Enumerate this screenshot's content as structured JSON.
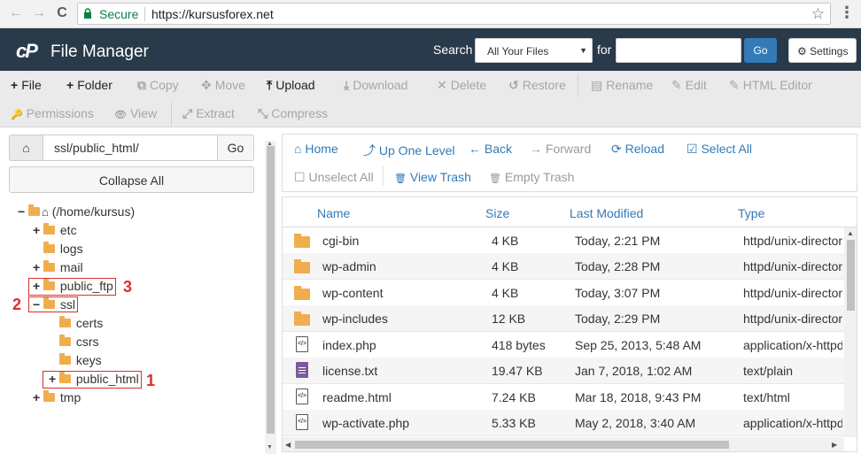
{
  "browser": {
    "back_glyph": "←",
    "forward_glyph": "→",
    "reload_glyph": "C",
    "secure_label": "Secure",
    "url": "https://kursusforex.net",
    "star_glyph": "☆",
    "menu_glyph": "⋮"
  },
  "header": {
    "logo_text": "cP",
    "title": "File Manager",
    "search_label": "Search",
    "search_scope": "All Your Files",
    "for_label": "for",
    "search_value": "",
    "go_label": "Go",
    "settings_label": "Settings"
  },
  "toolbar": {
    "row1": [
      {
        "icon": "+",
        "label": "File",
        "enabled": true
      },
      {
        "icon": "+",
        "label": "Folder",
        "enabled": true
      },
      {
        "icon": "⧉",
        "label": "Copy",
        "enabled": false
      },
      {
        "icon": "✥",
        "label": "Move",
        "enabled": false
      },
      {
        "icon": "⤒",
        "label": "Upload",
        "enabled": true
      },
      {
        "icon": "⤓",
        "label": "Download",
        "enabled": false
      },
      {
        "icon": "✕",
        "label": "Delete",
        "enabled": false
      },
      {
        "icon": "↺",
        "label": "Restore",
        "enabled": false
      },
      {
        "icon": "▤",
        "label": "Rename",
        "enabled": false
      },
      {
        "icon": "✎",
        "label": "Edit",
        "enabled": false
      },
      {
        "icon": "✎",
        "label": "HTML Editor",
        "enabled": false
      }
    ],
    "row2": [
      {
        "icon": "🔑",
        "label": "Permissions",
        "enabled": false
      },
      {
        "icon": "👁",
        "label": "View",
        "enabled": false
      },
      {
        "icon": "⤢",
        "label": "Extract",
        "enabled": false
      },
      {
        "icon": "⤡",
        "label": "Compress",
        "enabled": false
      }
    ]
  },
  "left_panel": {
    "path_value": "ssl/public_html/",
    "go_label": "Go",
    "collapse_label": "Collapse All",
    "tree": [
      {
        "toggle": "−",
        "label": "(/home/kursus)",
        "level": 0,
        "home": true
      },
      {
        "toggle": "+",
        "label": "etc",
        "level": 1
      },
      {
        "toggle": "",
        "label": "logs",
        "level": 1
      },
      {
        "toggle": "+",
        "label": "mail",
        "level": 1
      },
      {
        "toggle": "+",
        "label": "public_ftp",
        "level": 1
      },
      {
        "toggle": "−",
        "label": "ssl",
        "level": 1
      },
      {
        "toggle": "",
        "label": "certs",
        "level": 2
      },
      {
        "toggle": "",
        "label": "csrs",
        "level": 2
      },
      {
        "toggle": "",
        "label": "keys",
        "level": 2
      },
      {
        "toggle": "+",
        "label": "public_html",
        "level": 2
      },
      {
        "toggle": "+",
        "label": "tmp",
        "level": 1
      }
    ],
    "annotations": [
      "1",
      "2",
      "3"
    ]
  },
  "right_toolbar": {
    "items": [
      {
        "icon": "⌂",
        "label": "Home",
        "enabled": true
      },
      {
        "icon": "⤴",
        "label": "Up One Level",
        "enabled": true
      },
      {
        "icon": "←",
        "label": "Back",
        "enabled": true
      },
      {
        "icon": "→",
        "label": "Forward",
        "enabled": false
      },
      {
        "icon": "⟳",
        "label": "Reload",
        "enabled": true
      },
      {
        "icon": "☑",
        "label": "Select All",
        "enabled": true
      },
      {
        "icon": "☐",
        "label": "Unselect All",
        "enabled": false
      },
      {
        "icon": "🗑",
        "label": "View Trash",
        "enabled": true
      },
      {
        "icon": "🗑",
        "label": "Empty Trash",
        "enabled": false
      }
    ]
  },
  "file_table": {
    "columns": [
      "Name",
      "Size",
      "Last Modified",
      "Type"
    ],
    "rows": [
      {
        "icon": "folder",
        "name": "cgi-bin",
        "size": "4 KB",
        "modified": "Today, 2:21 PM",
        "type": "httpd/unix-directory"
      },
      {
        "icon": "folder",
        "name": "wp-admin",
        "size": "4 KB",
        "modified": "Today, 2:28 PM",
        "type": "httpd/unix-directory"
      },
      {
        "icon": "folder",
        "name": "wp-content",
        "size": "4 KB",
        "modified": "Today, 3:07 PM",
        "type": "httpd/unix-directory"
      },
      {
        "icon": "folder",
        "name": "wp-includes",
        "size": "12 KB",
        "modified": "Today, 2:29 PM",
        "type": "httpd/unix-directory"
      },
      {
        "icon": "code",
        "name": "index.php",
        "size": "418 bytes",
        "modified": "Sep 25, 2013, 5:48 AM",
        "type": "application/x-httpd-php"
      },
      {
        "icon": "text",
        "name": "license.txt",
        "size": "19.47 KB",
        "modified": "Jan 7, 2018, 1:02 AM",
        "type": "text/plain"
      },
      {
        "icon": "code",
        "name": "readme.html",
        "size": "7.24 KB",
        "modified": "Mar 18, 2018, 9:43 PM",
        "type": "text/html"
      },
      {
        "icon": "code",
        "name": "wp-activate.php",
        "size": "5.33 KB",
        "modified": "May 2, 2018, 3:40 AM",
        "type": "application/x-httpd-php"
      }
    ]
  }
}
